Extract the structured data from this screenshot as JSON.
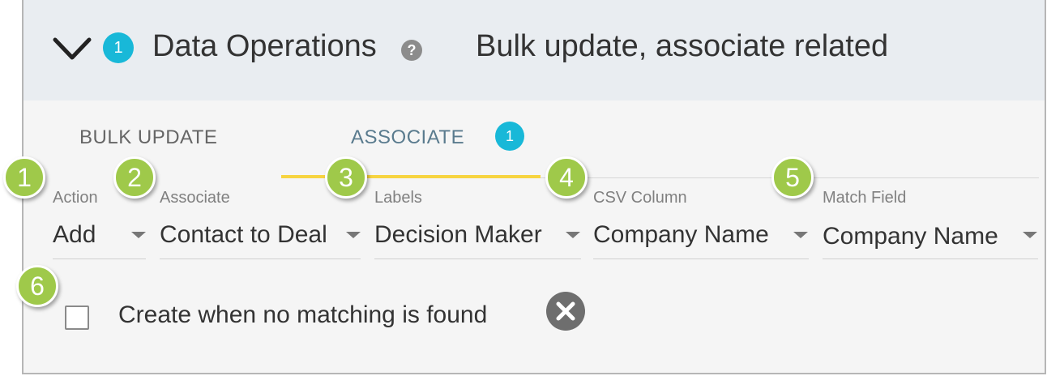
{
  "header": {
    "count_badge": "1",
    "title": "Data Operations",
    "help_icon_glyph": "?",
    "subtitle": "Bulk update, associate related"
  },
  "tabs": {
    "bulk_update": "BULK UPDATE",
    "associate": "ASSOCIATE",
    "associate_badge": "1",
    "active": "associate"
  },
  "fields": [
    {
      "label": "Action",
      "value": "Add"
    },
    {
      "label": "Associate",
      "value": "Contact to Deal"
    },
    {
      "label": "Labels",
      "value": "Decision Maker"
    },
    {
      "label": "CSV Column",
      "value": "Company Name"
    },
    {
      "label": "Match Field",
      "value": "Company Name"
    }
  ],
  "checkbox": {
    "label": "Create when no matching is found",
    "checked": false
  },
  "callouts": [
    "1",
    "2",
    "3",
    "4",
    "5",
    "6"
  ],
  "colors": {
    "badge": "#18b8d8",
    "callout": "#9fc94a",
    "tab_indicator": "#f7d440",
    "header_bg": "#e9edf1"
  }
}
